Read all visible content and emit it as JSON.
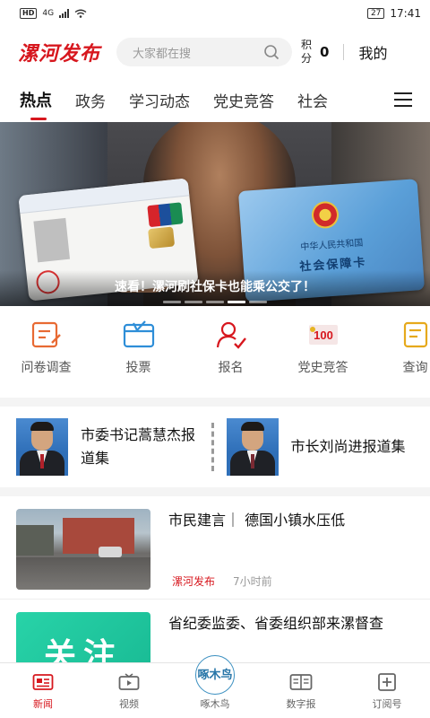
{
  "status_bar": {
    "network": "HD",
    "signal": "4G",
    "battery": "27",
    "time": "17:41"
  },
  "header": {
    "logo": "漯河发布",
    "search_placeholder": "大家都在搜",
    "points_label": "积分",
    "points_value": "0",
    "mine": "我的"
  },
  "tabs": [
    {
      "label": "热点",
      "active": true
    },
    {
      "label": "政务"
    },
    {
      "label": "学习动态"
    },
    {
      "label": "党史竞答"
    },
    {
      "label": "社会"
    }
  ],
  "banner": {
    "caption": "速看！漯河刷社保卡也能乘公交了！",
    "card_right_line1": "中华人民共和国",
    "card_right_line2": "社会保障卡",
    "slides": 5,
    "active_slide": 4
  },
  "services": [
    {
      "label": "问卷调查",
      "icon": "survey-icon"
    },
    {
      "label": "投票",
      "icon": "vote-icon"
    },
    {
      "label": "报名",
      "icon": "signup-icon"
    },
    {
      "label": "党史竞答",
      "icon": "party-history-icon"
    },
    {
      "label": "查询",
      "icon": "query-icon"
    }
  ],
  "leaders": [
    {
      "name": "市委书记蒿慧杰报道集"
    },
    {
      "name": "市长刘尚进报道集"
    }
  ],
  "news": [
    {
      "title": "市民建言｜ 德国小镇水压低",
      "source": "漯河发布",
      "time": "7小时前"
    },
    {
      "title": "省纪委监委、省委组织部来漯督查",
      "thumb_text": "关注"
    }
  ],
  "bottom_nav": [
    {
      "label": "新闻",
      "active": true
    },
    {
      "label": "视频"
    },
    {
      "label": "啄木鸟",
      "logo": "啄木鸟"
    },
    {
      "label": "数字报"
    },
    {
      "label": "订阅号"
    }
  ],
  "colors": {
    "brand_red": "#d7171e",
    "teal": "#1cc39c"
  }
}
